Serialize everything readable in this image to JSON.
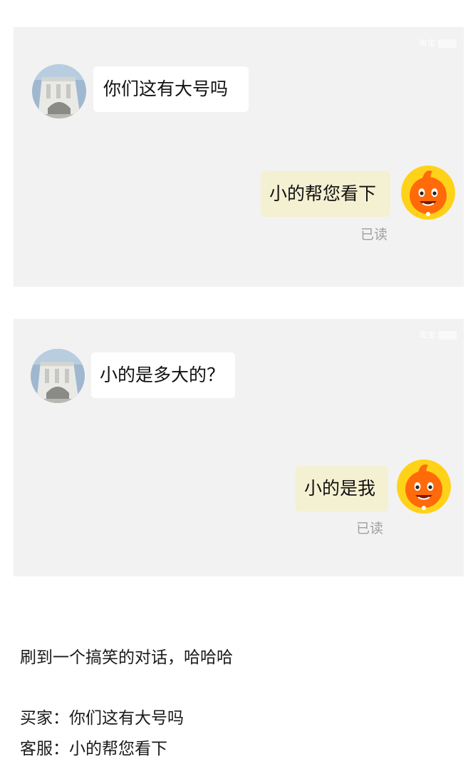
{
  "watermark": "淘宝",
  "panels": [
    {
      "incoming": {
        "text": "你们这有大号吗",
        "avatar_icon": "building-avatar-icon"
      },
      "outgoing": {
        "text": "小的帮您看下",
        "avatar_icon": "taobao-mascot-icon"
      },
      "read_status": "已读"
    },
    {
      "incoming": {
        "text": "小的是多大的？",
        "avatar_icon": "building-avatar-icon"
      },
      "outgoing": {
        "text": "小的是我",
        "avatar_icon": "taobao-mascot-icon"
      },
      "read_status": "已读"
    }
  ],
  "caption": {
    "intro": "刷到一个搞笑的对话，哈哈哈",
    "line1": "买家：你们这有大号吗",
    "line2": "客服：小的帮您看下"
  },
  "colors": {
    "panel_bg": "#f2f2f2",
    "incoming_bubble": "#ffffff",
    "outgoing_bubble": "#f4f0d2",
    "read_text": "#a0a0a0",
    "mascot_orange": "#ff6a0a",
    "mascot_ring": "#ffd21a"
  }
}
